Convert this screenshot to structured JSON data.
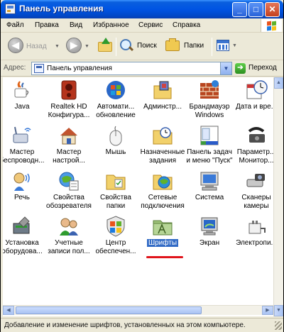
{
  "window": {
    "title": "Панель управления"
  },
  "menu": [
    "Файл",
    "Правка",
    "Вид",
    "Избранное",
    "Сервис",
    "Справка"
  ],
  "toolbar": {
    "back": "Назад",
    "search": "Поиск",
    "folders": "Папки"
  },
  "address": {
    "label": "Адрес:",
    "value": "Панель управления",
    "go": "Переход"
  },
  "items": [
    {
      "label": "Java",
      "icon": "java-icon"
    },
    {
      "label": "Realtek HD\nКонфигура...",
      "icon": "speaker-icon"
    },
    {
      "label": "Автомати...\nобновление",
      "icon": "windows-update-icon"
    },
    {
      "label": "Админстр...",
      "icon": "admin-tools-icon"
    },
    {
      "label": "Брандмауэр\nWindows",
      "icon": "firewall-icon"
    },
    {
      "label": "Дата и вре...",
      "icon": "clock-icon"
    },
    {
      "label": "Мастер\nбеспроводн...",
      "icon": "wireless-icon"
    },
    {
      "label": "Мастер\nнастрой...",
      "icon": "home-network-icon"
    },
    {
      "label": "Мышь",
      "icon": "mouse-icon"
    },
    {
      "label": "Назначенные\nзадания",
      "icon": "scheduled-tasks-icon"
    },
    {
      "label": "Панель задач\nи меню \"Пуск\"",
      "icon": "taskbar-icon"
    },
    {
      "label": "Параметр...\nМонитор...",
      "icon": "phone-icon"
    },
    {
      "label": "Речь",
      "icon": "speech-icon"
    },
    {
      "label": "Свойства\nобозревателя",
      "icon": "internet-options-icon"
    },
    {
      "label": "Свойства\nпапки",
      "icon": "folder-options-icon"
    },
    {
      "label": "Сетевые\nподключения",
      "icon": "network-icon"
    },
    {
      "label": "Система",
      "icon": "system-icon"
    },
    {
      "label": "Сканеры\nкамеры",
      "icon": "scanner-icon"
    },
    {
      "label": "Установка\nоборудова...",
      "icon": "hardware-icon"
    },
    {
      "label": "Учетные\nзаписи пол...",
      "icon": "users-icon"
    },
    {
      "label": "Центр\nобеспечен...",
      "icon": "security-center-icon"
    },
    {
      "label": "Шрифты",
      "icon": "fonts-folder-icon"
    },
    {
      "label": "Экран",
      "icon": "display-icon"
    },
    {
      "label": "Электропи...",
      "icon": "power-icon"
    }
  ],
  "status": "Добавление и изменение шрифтов, установленных на этом компьютере."
}
